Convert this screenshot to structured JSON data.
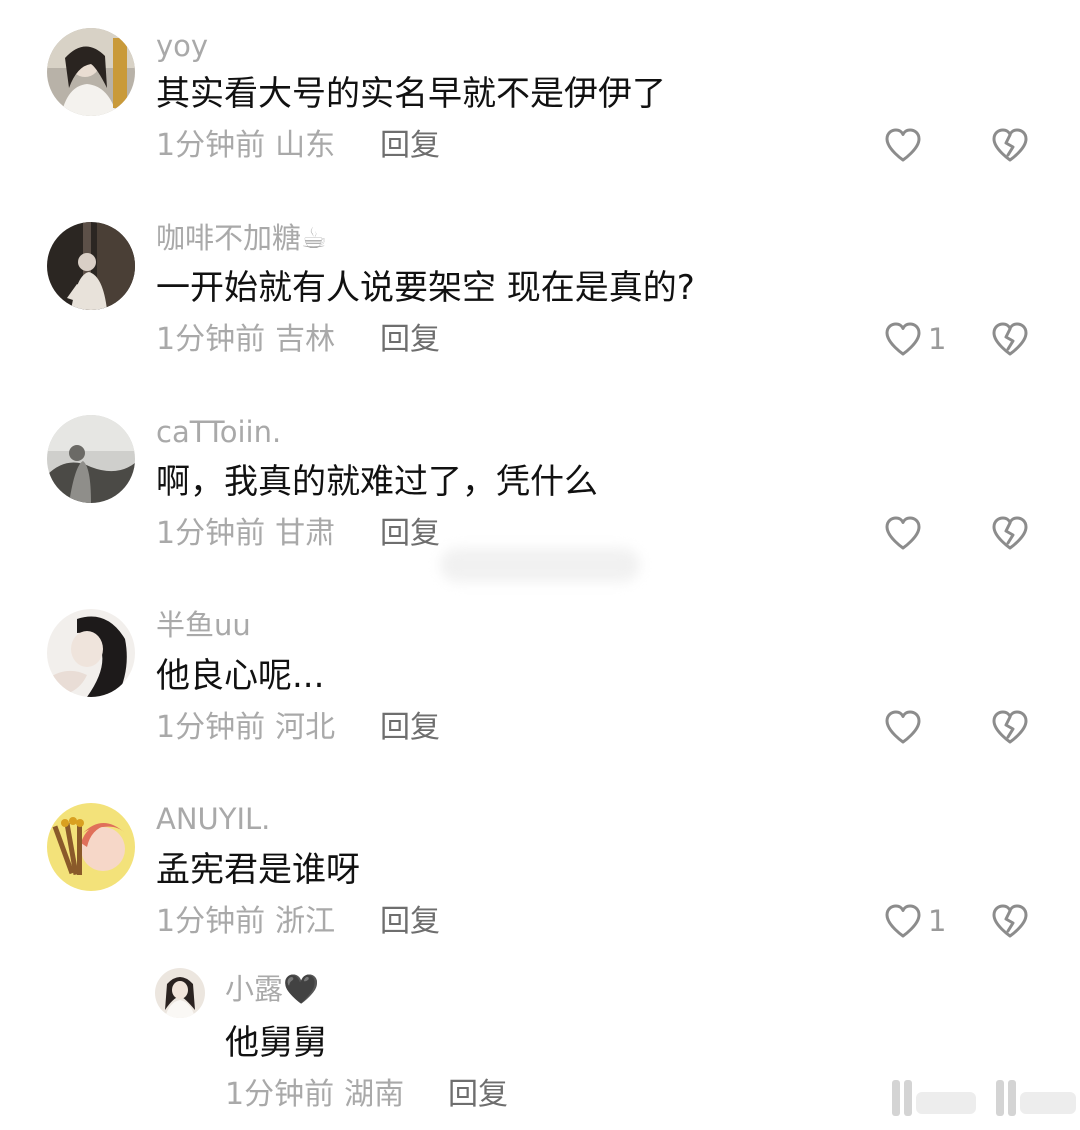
{
  "comments": [
    {
      "username": "yoy",
      "text": "其实看大号的实名早就不是伊伊了",
      "time": "1分钟前",
      "location": "山东",
      "reply_label": "回复",
      "like_count": "",
      "avatar_icon": "user-avatar-photo"
    },
    {
      "username": "咖啡不加糖☕",
      "text": "一开始就有人说要架空 现在是真的?",
      "time": "1分钟前",
      "location": "吉林",
      "reply_label": "回复",
      "like_count": "1",
      "avatar_icon": "user-avatar-photo"
    },
    {
      "username": "caTToiin.",
      "text": "啊，我真的就难过了，凭什么",
      "time": "1分钟前",
      "location": "甘肃",
      "reply_label": "回复",
      "like_count": "",
      "avatar_icon": "user-avatar-photo"
    },
    {
      "username": "半鱼uu",
      "text": "他良心呢...",
      "time": "1分钟前",
      "location": "河北",
      "reply_label": "回复",
      "like_count": "",
      "avatar_icon": "user-avatar-photo"
    },
    {
      "username": "ANUYIL.",
      "text": "孟宪君是谁呀",
      "time": "1分钟前",
      "location": "浙江",
      "reply_label": "回复",
      "like_count": "1",
      "avatar_icon": "user-avatar-illustration"
    }
  ],
  "reply": {
    "username": "小露🖤",
    "text": "他舅舅",
    "time": "1分钟前",
    "location": "湖南",
    "reply_label": "回复",
    "avatar_icon": "user-avatar-photo"
  },
  "icons": {
    "like": "heart-outline-icon",
    "dislike": "broken-heart-icon"
  },
  "colors": {
    "background": "#ffffff",
    "username": "#a9a9a9",
    "text": "#111111",
    "meta": "#a9a9a9",
    "reply": "#6e6e6e",
    "icon": "#8c8c8c"
  }
}
